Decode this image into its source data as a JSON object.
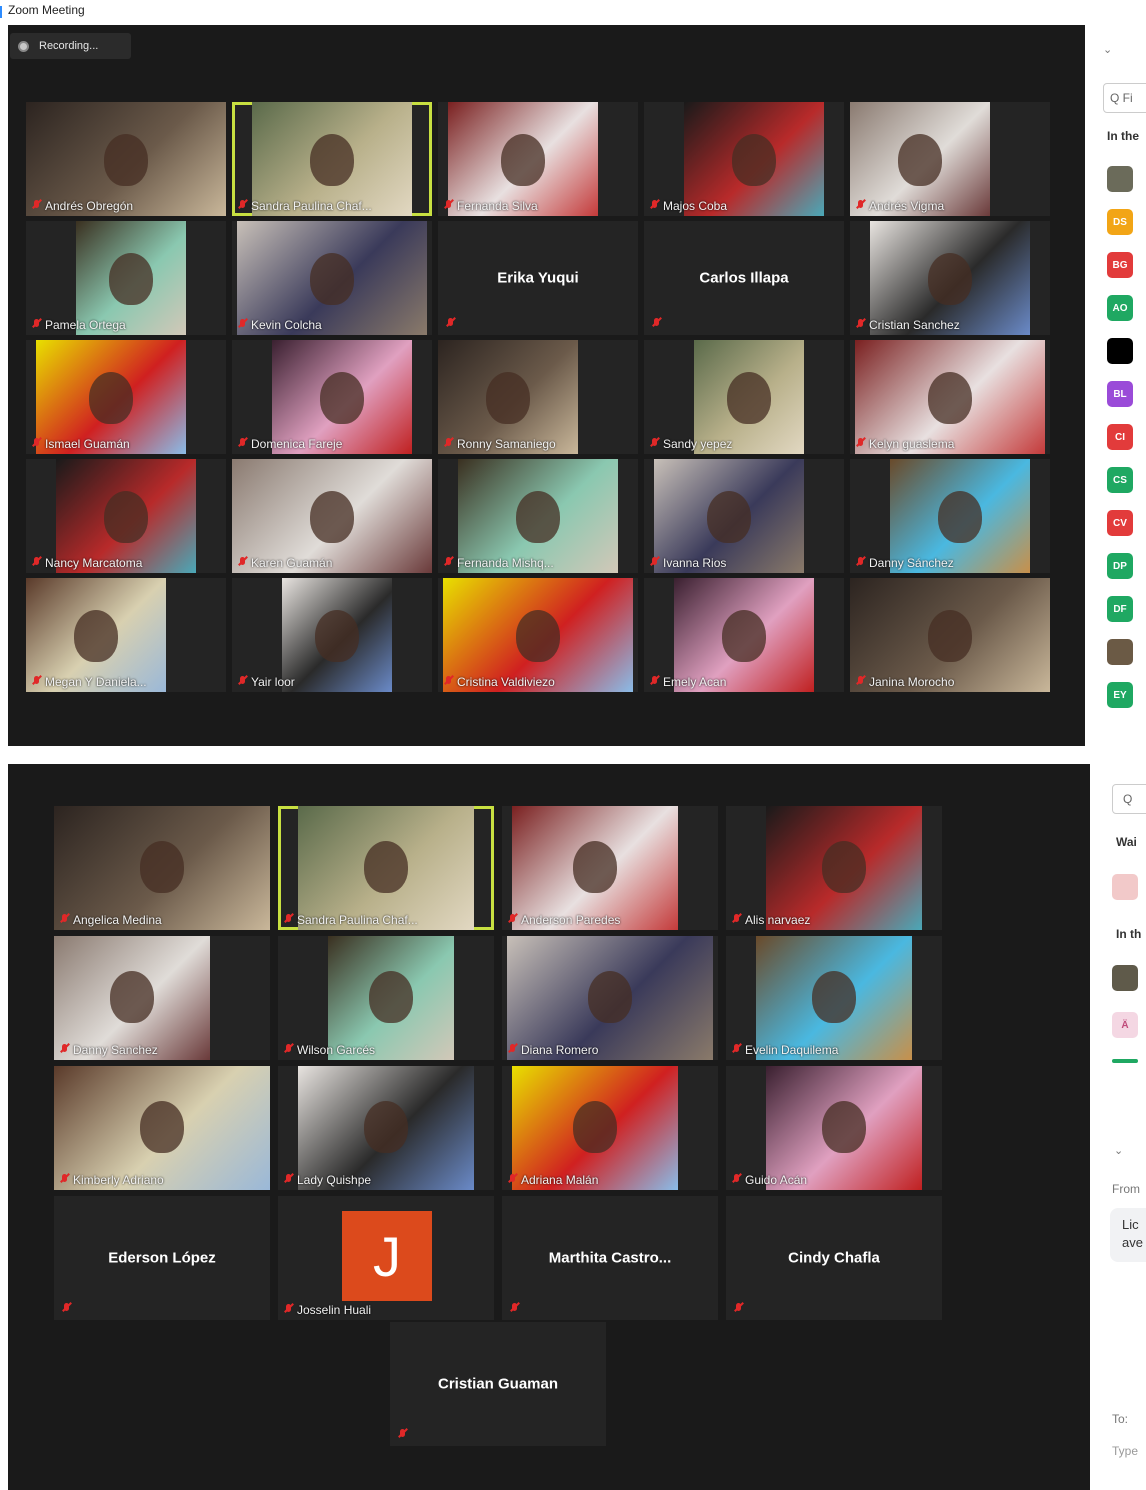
{
  "window": {
    "title": "Zoom Meeting"
  },
  "recording": {
    "label": "Recording..."
  },
  "gallery1": {
    "tiles": [
      {
        "name": "Andrés Obregón",
        "video": true
      },
      {
        "name": "Sandra Paulina Chaf...",
        "video": true,
        "active": true
      },
      {
        "name": "Fernanda Silva",
        "video": true
      },
      {
        "name": "Majos Coba",
        "video": true
      },
      {
        "name": "Andrés Vigma",
        "video": true
      },
      {
        "name": "Pamela Ortega",
        "video": true
      },
      {
        "name": "Kevin Colcha",
        "video": true
      },
      {
        "name": "Erika Yuqui",
        "video": false
      },
      {
        "name": "Carlos Illapa",
        "video": false
      },
      {
        "name": "Cristian Sanchez",
        "video": true
      },
      {
        "name": "Ismael Guamán",
        "video": true
      },
      {
        "name": "Domenica Fareje",
        "video": true
      },
      {
        "name": "Ronny Samaniego",
        "video": true
      },
      {
        "name": "Sandy yepez",
        "video": true
      },
      {
        "name": "Kelyn guaslema",
        "video": true
      },
      {
        "name": "Nancy Marcatoma",
        "video": true
      },
      {
        "name": "Karen Guamán",
        "video": true
      },
      {
        "name": "Fernanda Mishq...",
        "video": true
      },
      {
        "name": "Ivanna Rios",
        "video": true
      },
      {
        "name": "Danny Sánchez",
        "video": true
      },
      {
        "name": "Megan Y Daniela...",
        "video": true
      },
      {
        "name": "Yair loor",
        "video": true
      },
      {
        "name": "Cristina Valdiviezo",
        "video": true
      },
      {
        "name": "Emely Acan",
        "video": true
      },
      {
        "name": "Janina Morocho",
        "video": true
      }
    ]
  },
  "gallery2": {
    "tiles": [
      {
        "name": "Angelica Medina",
        "video": true
      },
      {
        "name": "Sandra Paulina Chaf...",
        "video": true,
        "active": true
      },
      {
        "name": "Anderson Paredes",
        "video": true
      },
      {
        "name": "Alis narvaez",
        "video": true
      },
      {
        "name": "Danny Sanchez",
        "video": true
      },
      {
        "name": "Wilson Garcés",
        "video": true
      },
      {
        "name": "Diana Romero",
        "video": true
      },
      {
        "name": "Evelin Daquilema",
        "video": true
      },
      {
        "name": "Kimberly Adriano",
        "video": true
      },
      {
        "name": "Lady Quishpe",
        "video": true
      },
      {
        "name": "Adriana Malán",
        "video": true
      },
      {
        "name": "Guido Acán",
        "video": true
      },
      {
        "name": "Ederson López",
        "video": false
      },
      {
        "name": "Josselin Huali",
        "video": false,
        "avatar": "J"
      },
      {
        "name": "Marthita  Castro...",
        "video": false
      },
      {
        "name": "Cindy Chafla",
        "video": false
      },
      {
        "name": "Cristian Guaman",
        "video": false
      }
    ]
  },
  "sidebar1": {
    "search_placeholder": "Q Fi",
    "section": "In the",
    "avatars": [
      {
        "initials": "",
        "color": "#6b6b5a"
      },
      {
        "initials": "DS",
        "color": "#f2a516"
      },
      {
        "initials": "BG",
        "color": "#e23b3b"
      },
      {
        "initials": "AO",
        "color": "#1fa862"
      },
      {
        "initials": "",
        "color": "#000000"
      },
      {
        "initials": "BL",
        "color": "#9a4bd8"
      },
      {
        "initials": "CI",
        "color": "#e23b3b"
      },
      {
        "initials": "CS",
        "color": "#1fa862"
      },
      {
        "initials": "CV",
        "color": "#e23b3b"
      },
      {
        "initials": "DP",
        "color": "#1fa862"
      },
      {
        "initials": "DF",
        "color": "#1fa862"
      },
      {
        "initials": "",
        "color": "#6b5a45"
      },
      {
        "initials": "EY",
        "color": "#1fa862"
      }
    ]
  },
  "sidebar2": {
    "search_placeholder": "Q",
    "section_waiting": "Wai",
    "section_in": "In th",
    "from_label": "From",
    "message_text": "Lic ave",
    "to_label": "To:",
    "type_placeholder": "Type"
  }
}
